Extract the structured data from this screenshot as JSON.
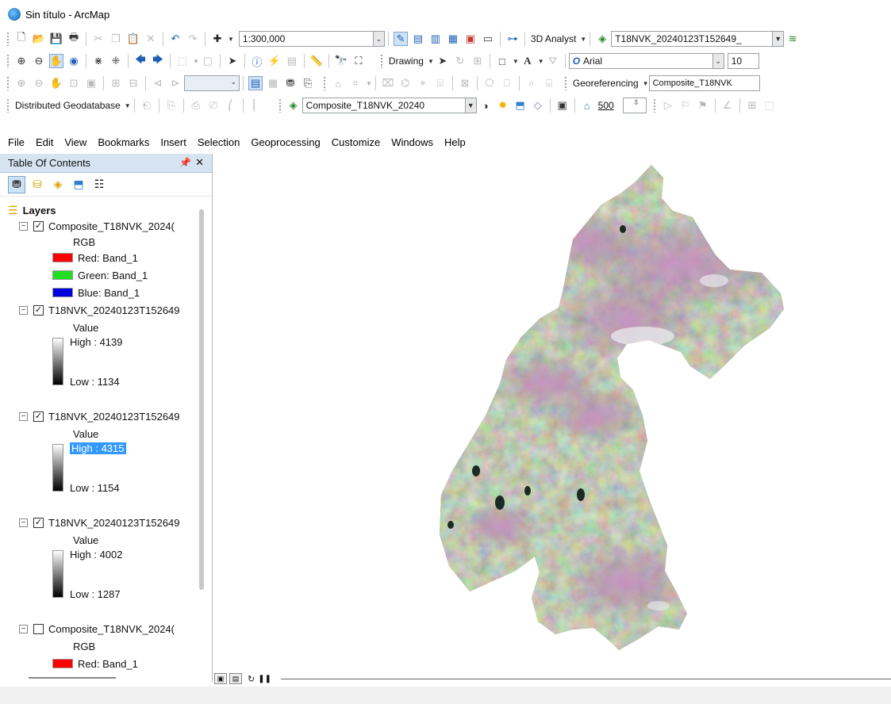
{
  "window": {
    "title": "Sin título - ArcMap"
  },
  "toolbar1": {
    "scale_value": "1:300,000",
    "analyst_label": "3D Analyst",
    "layer_combo": "T18NVK_20240123T152649_"
  },
  "toolbar2": {
    "drawing_label": "Drawing",
    "font_name": "Arial",
    "font_size": "10"
  },
  "toolbar3": {
    "georef_label": "Georeferencing",
    "georef_combo": "Composite_T18NVK"
  },
  "toolbar4": {
    "distributed_label": "Distributed Geodatabase",
    "composite_combo": "Composite_T18NVK_20240",
    "zoom_value": "500"
  },
  "menubar": [
    "File",
    "Edit",
    "View",
    "Bookmarks",
    "Insert",
    "Selection",
    "Geoprocessing",
    "Customize",
    "Windows",
    "Help"
  ],
  "toc": {
    "title": "Table Of Contents",
    "root": "Layers",
    "layer1": {
      "name": "Composite_T18NVK_2024(",
      "type": "RGB",
      "red": "Red:   Band_1",
      "green": "Green: Band_1",
      "blue": "Blue:   Band_1"
    },
    "layer2": {
      "name": "T18NVK_20240123T152649",
      "value": "Value",
      "high": "High : 4139",
      "low": "Low : 1134"
    },
    "layer3": {
      "name": "T18NVK_20240123T152649",
      "value": "Value",
      "high": "High : 4315",
      "low": "Low : 1154"
    },
    "layer4": {
      "name": "T18NVK_20240123T152649",
      "value": "Value",
      "high": "High : 4002",
      "low": "Low : 1287"
    },
    "layer5": {
      "name": "Composite_T18NVK_2024(",
      "type": "RGB",
      "red": "Red:   Band_1"
    }
  },
  "colors": {
    "red": "#ff0000",
    "green": "#22dd22",
    "blue": "#0000dd",
    "highlight": "#3399ff",
    "toc_header": "#d6e4f2"
  }
}
